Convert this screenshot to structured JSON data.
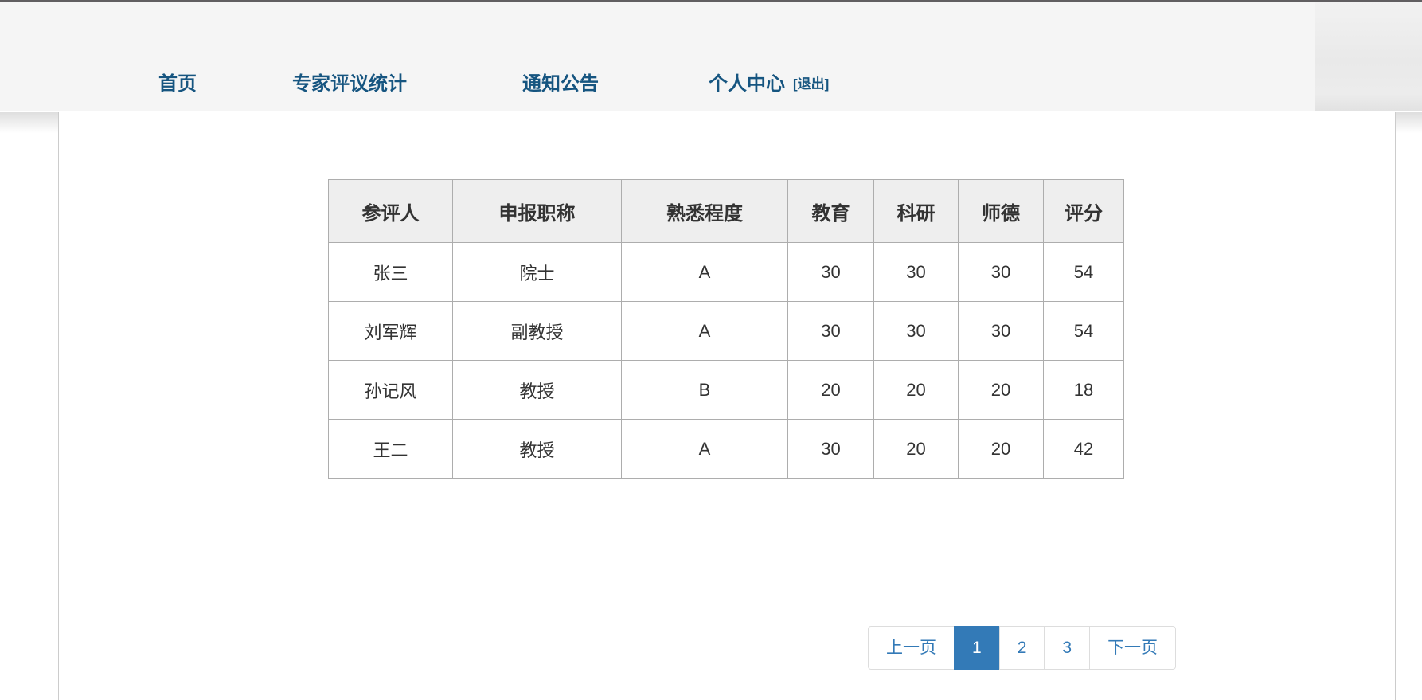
{
  "nav": {
    "items": [
      {
        "label": "首页"
      },
      {
        "label": "专家评议统计"
      },
      {
        "label": "通知公告"
      },
      {
        "label": "个人中心"
      }
    ],
    "logout_label": "[退出]"
  },
  "table": {
    "columns": [
      "参评人",
      "申报职称",
      "熟悉程度",
      "教育",
      "科研",
      "师德",
      "评分"
    ],
    "rows": [
      [
        "张三",
        "院士",
        "A",
        "30",
        "30",
        "30",
        "54"
      ],
      [
        "刘军辉",
        "副教授",
        "A",
        "30",
        "30",
        "30",
        "54"
      ],
      [
        "孙记风",
        "教授",
        "B",
        "20",
        "20",
        "20",
        "18"
      ],
      [
        "王二",
        "教授",
        "A",
        "30",
        "20",
        "20",
        "42"
      ]
    ]
  },
  "pagination": {
    "prev_label": "上一页",
    "next_label": "下一页",
    "pages": [
      "1",
      "2",
      "3"
    ],
    "active_page": "1"
  },
  "colors": {
    "header_bg": "#f5f5f5",
    "nav_link": "#165580",
    "table_header_bg": "#eeeeee",
    "table_border": "#adadad",
    "pagination_link": "#337ab7",
    "pagination_active_bg": "#337ab7"
  }
}
